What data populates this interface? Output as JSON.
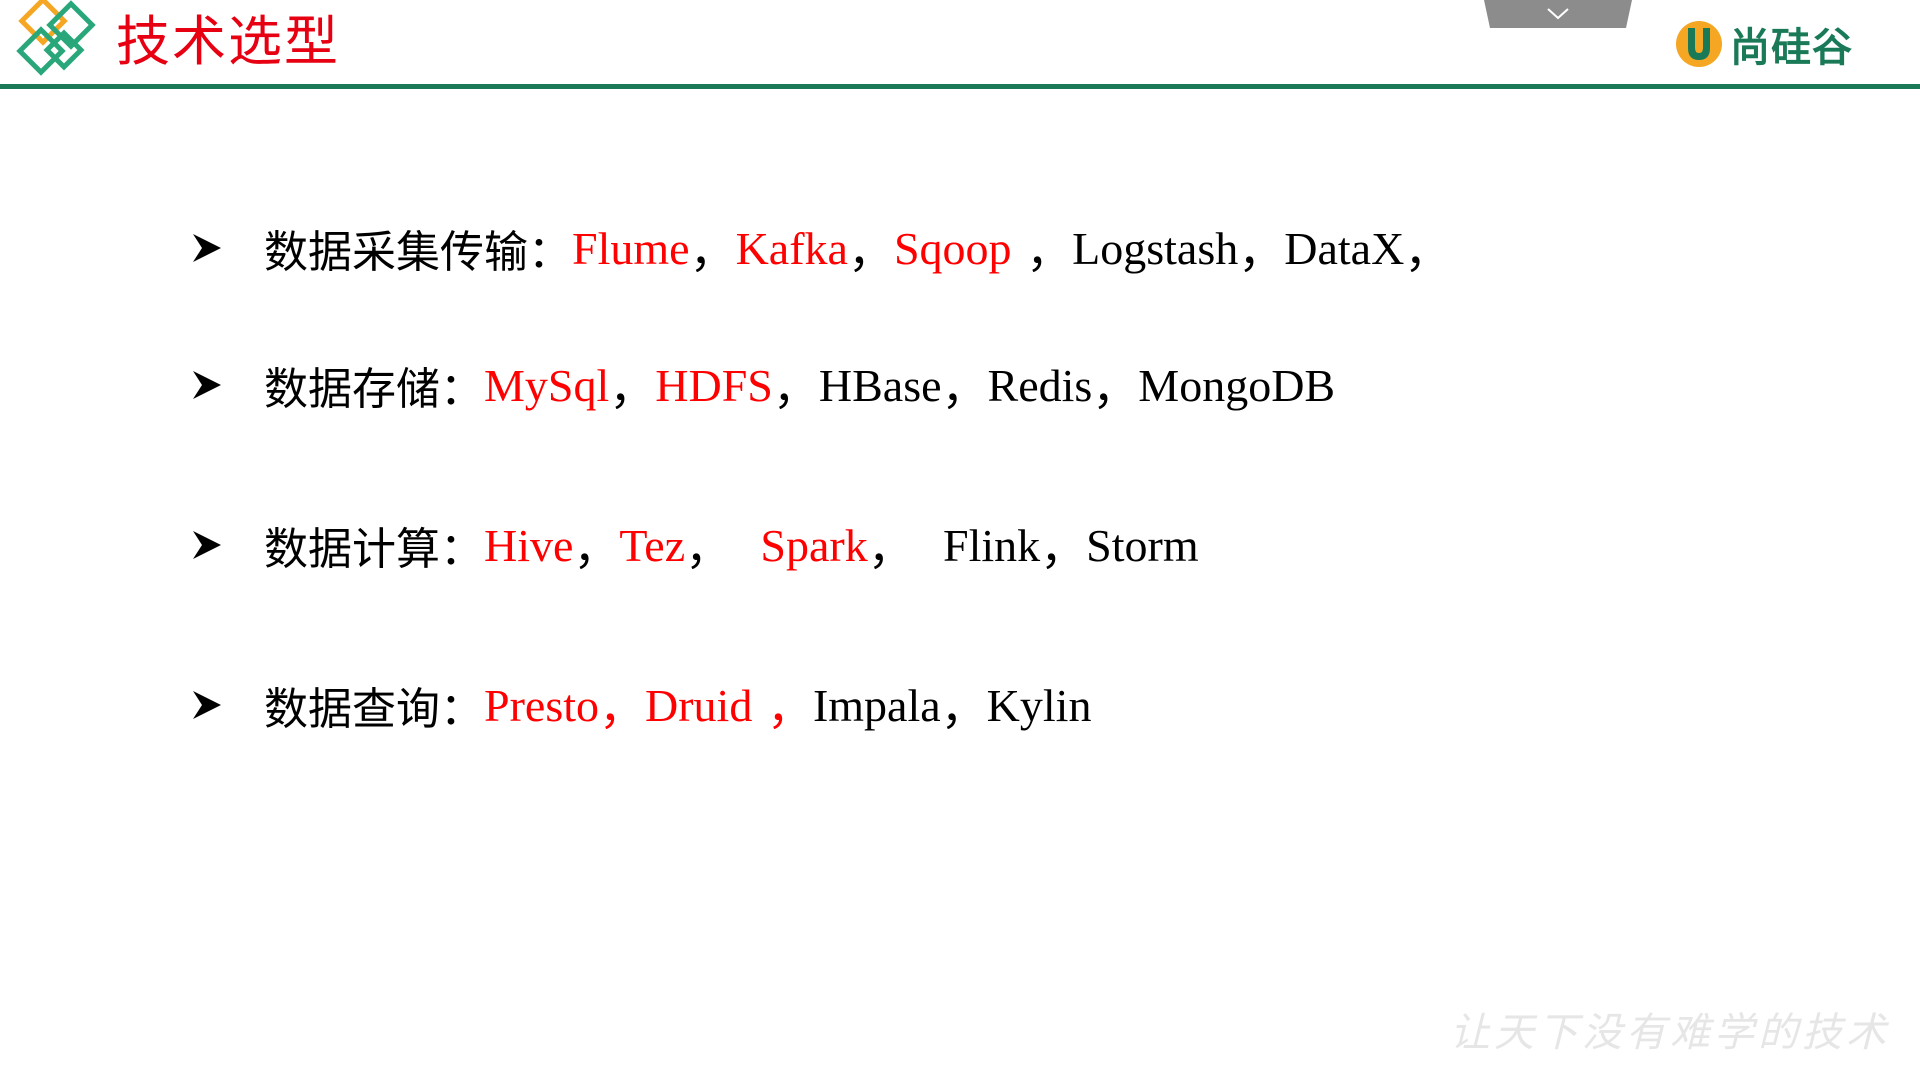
{
  "slide": {
    "title": "技术选型",
    "brand": {
      "name": "尚硅谷"
    },
    "motto": "让天下没有难学的技术",
    "colors": {
      "title": "#e60012",
      "rule": "#1a7a57",
      "highlight": "#ff0000",
      "text": "#000000",
      "collapse_tab": "#8c8c8c",
      "logo_orange": "#f5a623",
      "logo_green": "#2aa77a"
    }
  },
  "bullets": [
    {
      "label": "数据采集传输：",
      "items": [
        {
          "text": "Flume",
          "sep": "，",
          "highlight": true
        },
        {
          "text": "Kafka",
          "sep": "，",
          "highlight": true
        },
        {
          "text": "Sqoop",
          "sep": " ，",
          "highlight": true,
          "sep_highlight": false
        },
        {
          "text": "Logstash",
          "sep": "，",
          "highlight": false
        },
        {
          "text": "DataX",
          "sep": "，",
          "highlight": false
        }
      ]
    },
    {
      "label": "数据存储：",
      "items": [
        {
          "text": "MySql",
          "sep": "，",
          "highlight": true,
          "sep_highlight": false
        },
        {
          "text": "HDFS",
          "sep": "，",
          "highlight": true,
          "sep_highlight": false
        },
        {
          "text": "HBase",
          "sep": "，",
          "highlight": false
        },
        {
          "text": "Redis",
          "sep": "，",
          "highlight": false
        },
        {
          "text": "MongoDB",
          "sep": "",
          "highlight": false
        }
      ]
    },
    {
      "label": "数据计算：",
      "items": [
        {
          "text": "Hive",
          "sep": "，",
          "highlight": true,
          "sep_highlight": false
        },
        {
          "text": "Tez",
          "sep": "，  ",
          "highlight": true,
          "sep_highlight": false
        },
        {
          "text": "Spark",
          "sep": "，  ",
          "highlight": true,
          "sep_highlight": false
        },
        {
          "text": "Flink",
          "sep": "，",
          "highlight": false
        },
        {
          "text": "Storm",
          "sep": "",
          "highlight": false
        }
      ]
    },
    {
      "label": "数据查询：",
      "items": [
        {
          "text": "Presto",
          "sep": "，",
          "highlight": true,
          "sep_highlight": true
        },
        {
          "text": "Druid",
          "sep": " ，",
          "highlight": true,
          "sep_highlight": true
        },
        {
          "text": "Impala",
          "sep": "，",
          "highlight": false
        },
        {
          "text": "Kylin",
          "sep": "",
          "highlight": false
        }
      ]
    }
  ]
}
